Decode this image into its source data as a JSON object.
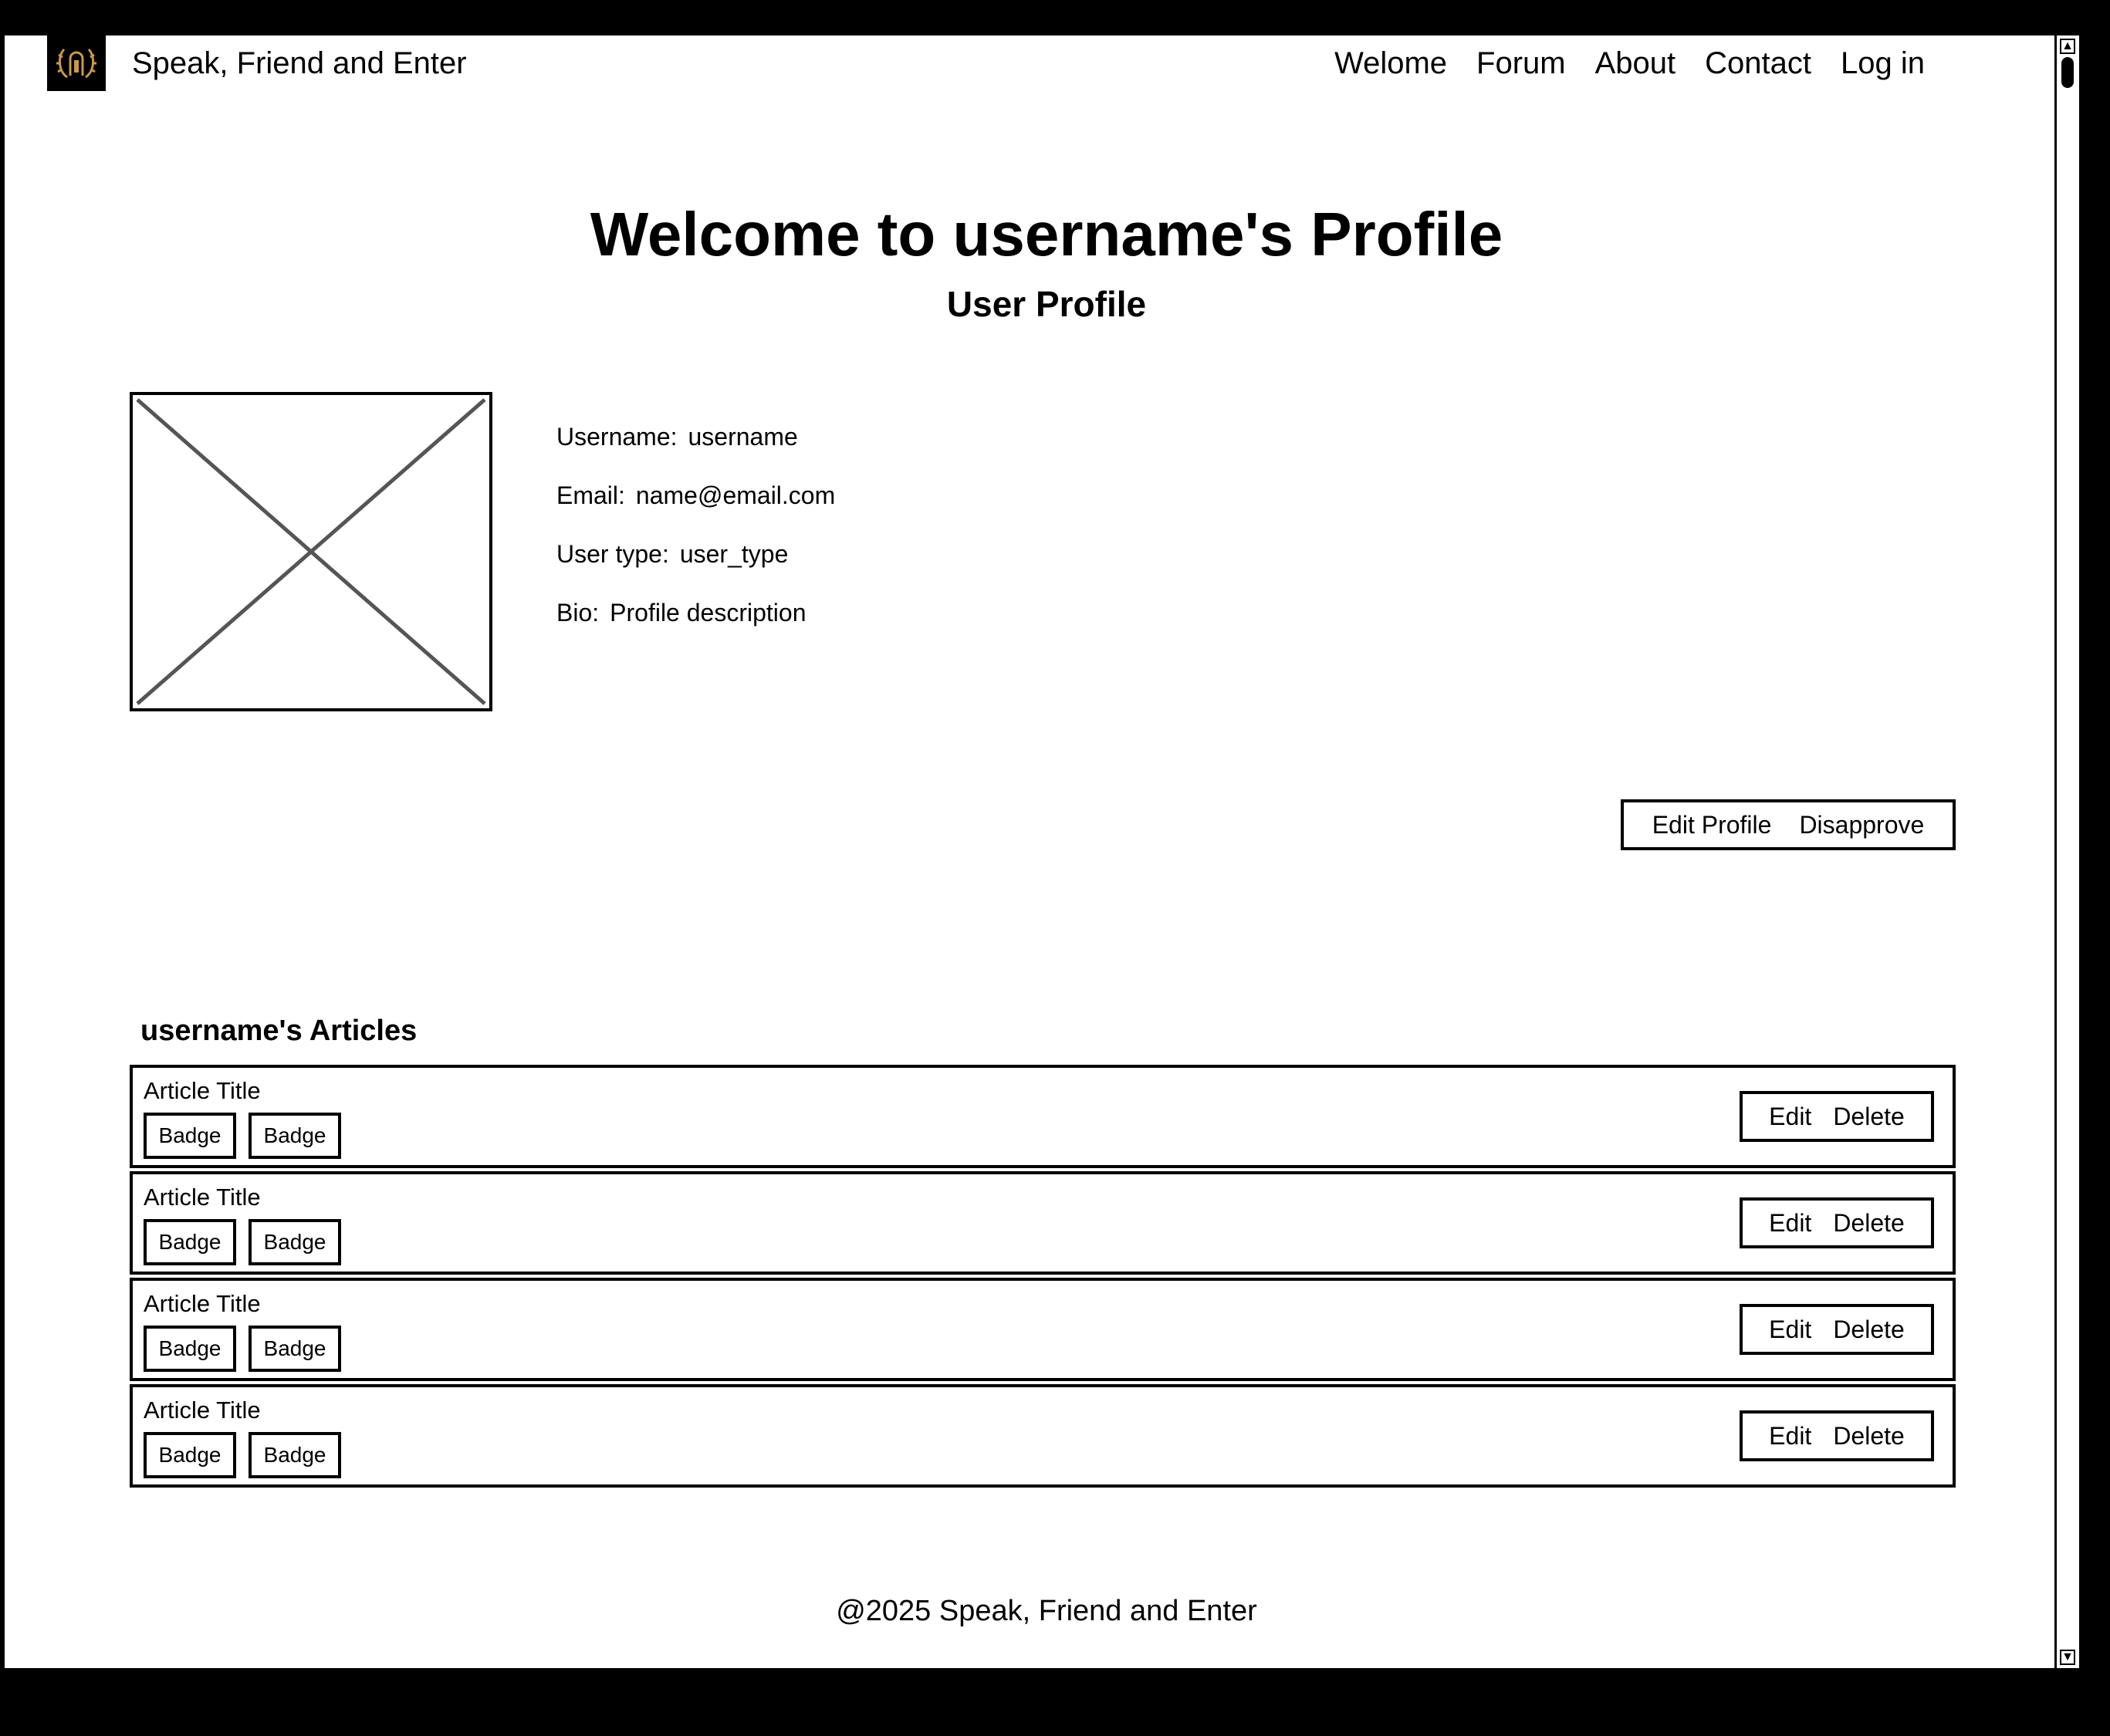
{
  "header": {
    "brand": "Speak, Friend and Enter",
    "nav": [
      "Welome",
      "Forum",
      "About",
      "Contact",
      "Log in"
    ]
  },
  "page": {
    "title": "Welcome to username's Profile",
    "subtitle": "User Profile"
  },
  "profile": {
    "fields": [
      {
        "label": "Username:",
        "value": "username"
      },
      {
        "label": "Email:",
        "value": "name@email.com"
      },
      {
        "label": "User type:",
        "value": "user_type"
      },
      {
        "label": "Bio:",
        "value": "Profile description"
      }
    ],
    "actions": {
      "edit": "Edit Profile",
      "disapprove": "Disapprove"
    }
  },
  "articles": {
    "heading": "username's Articles",
    "items": [
      {
        "title": "Article Title",
        "badges": [
          "Badge",
          "Badge"
        ],
        "edit": "Edit",
        "delete": "Delete"
      },
      {
        "title": "Article Title",
        "badges": [
          "Badge",
          "Badge"
        ],
        "edit": "Edit",
        "delete": "Delete"
      },
      {
        "title": "Article Title",
        "badges": [
          "Badge",
          "Badge"
        ],
        "edit": "Edit",
        "delete": "Delete"
      },
      {
        "title": "Article Title",
        "badges": [
          "Badge",
          "Badge"
        ],
        "edit": "Edit",
        "delete": "Delete"
      }
    ]
  },
  "footer": {
    "text": "@2025 Speak, Friend and Enter"
  },
  "icons": {
    "logo": "door-wreath-icon",
    "avatar": "image-placeholder-icon"
  },
  "colors": {
    "logo_bg": "#000000",
    "logo_gold": "#c99a4a"
  }
}
